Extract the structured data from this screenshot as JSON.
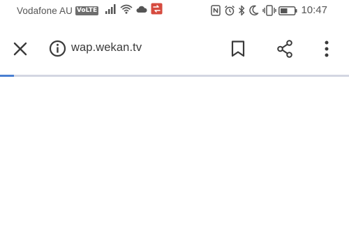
{
  "status_bar": {
    "carrier": "Vodafone AU",
    "network_badge": "VoLTE",
    "time": "10:47",
    "icons": [
      "volte-badge",
      "signal-icon",
      "wifi-icon",
      "cloud-icon",
      "notification-app-icon",
      "nfc-icon",
      "alarm-icon",
      "bluetooth-icon",
      "do-not-disturb-icon",
      "vibrate-icon",
      "battery-icon"
    ],
    "battery_level": 0.5
  },
  "toolbar": {
    "url": "wap.wekan.tv",
    "icons": [
      "close-icon",
      "site-info-icon",
      "bookmark-icon",
      "share-icon",
      "more-options-icon"
    ]
  },
  "page": {
    "load_progress": 0.04
  },
  "colors": {
    "progress": "#4a7fd1",
    "progress_track": "#d3d6e2",
    "notification_app": "#d64b3f"
  }
}
